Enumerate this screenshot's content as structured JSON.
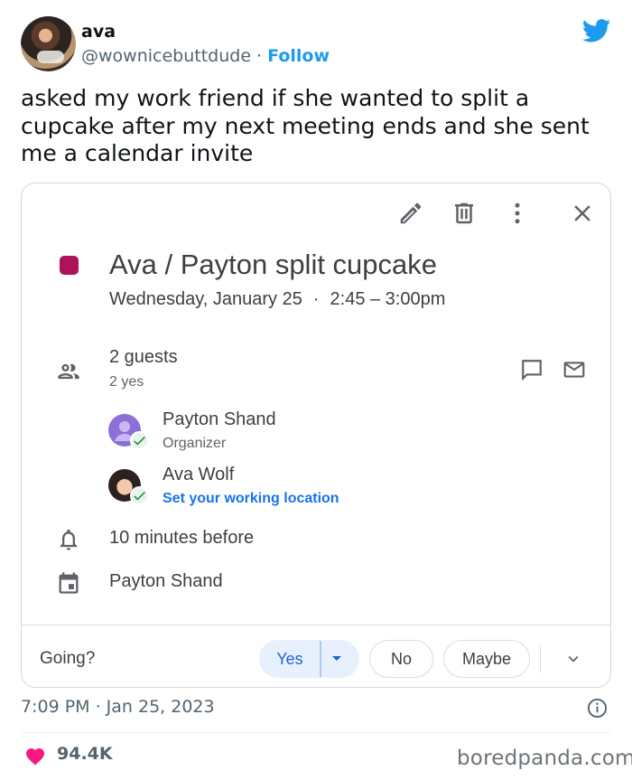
{
  "tweet": {
    "display_name": "ava",
    "handle": "@wownicebuttdude",
    "separator": " · ",
    "follow_label": "Follow",
    "text": "asked my work friend if she wanted to split a cupcake after my next meeting ends and she sent me a calendar invite",
    "timestamp": "7:09 PM · Jan 25, 2023",
    "likes": "94.4K"
  },
  "event": {
    "color": "#ad1457",
    "title": "Ava / Payton split cupcake",
    "date": "Wednesday, January 25",
    "date_sep": "·",
    "time": "2:45 – 3:00pm",
    "guests_count": "2 guests",
    "guests_yes": "2 yes",
    "guests": [
      {
        "name": "Payton Shand",
        "role": "Organizer"
      },
      {
        "name": "Ava Wolf",
        "role": "Set your working location"
      }
    ],
    "reminder": "10 minutes before",
    "calendar_owner": "Payton Shand"
  },
  "rsvp": {
    "prompt": "Going?",
    "yes_label": "Yes",
    "no_label": "No",
    "maybe_label": "Maybe"
  },
  "icons": {
    "edit": "pencil-icon",
    "delete": "trash-icon",
    "options": "more-vert-icon",
    "close": "close-icon",
    "guests": "people-icon",
    "chat": "chat-icon",
    "email": "mail-icon",
    "reminder": "bell-icon",
    "calendar": "calendar-icon"
  },
  "watermark": "boredpanda.com"
}
